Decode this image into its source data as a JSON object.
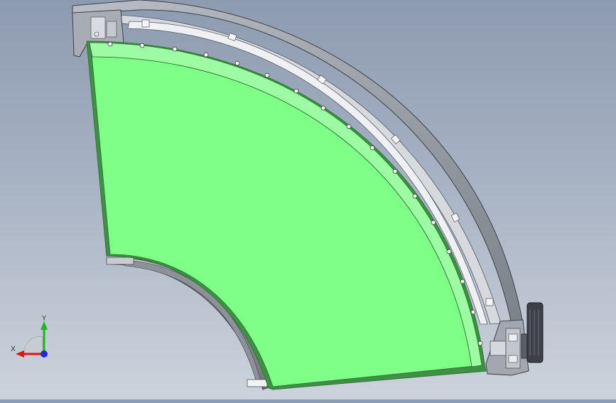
{
  "scene": {
    "title": "",
    "colors": {
      "background_top": "#8d9bb0",
      "background_bottom": "#cdd3dc",
      "belt_surface": "#80ff88",
      "belt_edge": "#2e7a33",
      "belt_shadow": "#5fc267",
      "frame_metal": "#9ea4ad",
      "frame_dark": "#4a4f57",
      "guide_rail": "#e8eaee",
      "knob": "#3d4147"
    }
  },
  "triad": {
    "x_label": "X",
    "y_label": "Y",
    "x_color": "#e0151b",
    "y_color": "#1bb81b",
    "z_color": "#1e2bd6"
  },
  "components": [
    {
      "name": "curved-belt-surface",
      "icon": "curved-belt"
    },
    {
      "name": "outer-side-guard",
      "icon": "curved-guard"
    },
    {
      "name": "inner-side-guard",
      "icon": "curved-guard"
    },
    {
      "name": "drive-end-knob",
      "icon": "knob"
    },
    {
      "name": "idler-end-bracket",
      "icon": "bracket"
    }
  ]
}
